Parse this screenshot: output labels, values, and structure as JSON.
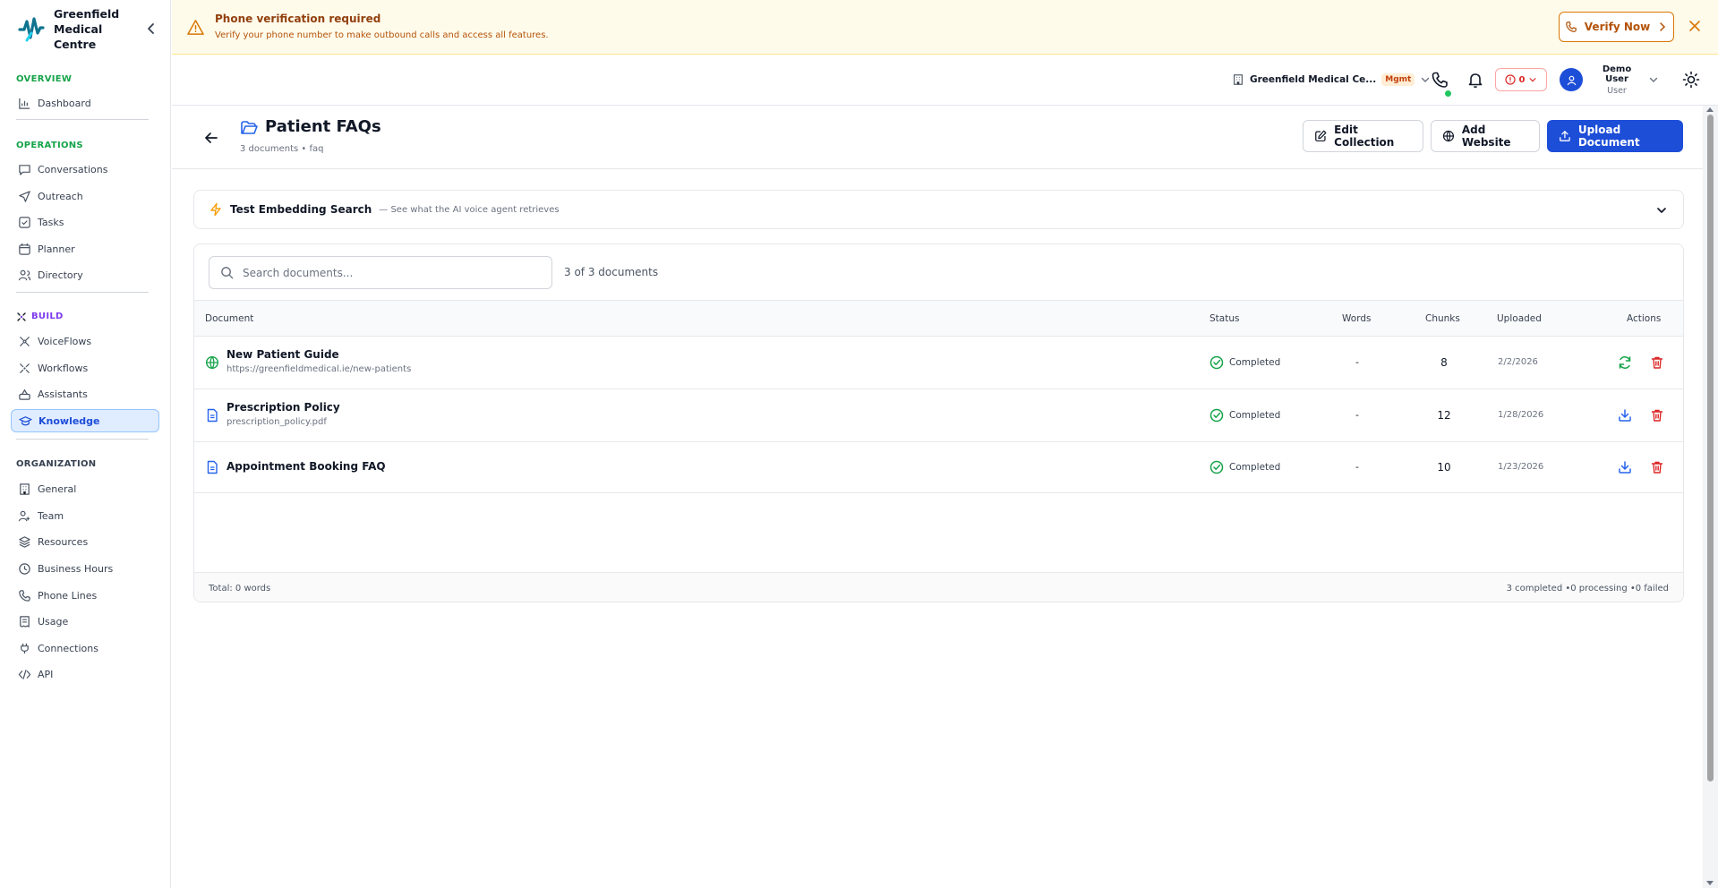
{
  "brand": {
    "name": "Greenfield Medical Centre"
  },
  "sidebar": {
    "overview_label": "OVERVIEW",
    "operations_label": "OPERATIONS",
    "build_label": "BUILD",
    "organization_label": "ORGANIZATION",
    "overview": [
      {
        "label": "Dashboard",
        "icon": "chart-icon"
      }
    ],
    "operations": [
      {
        "label": "Conversations",
        "icon": "chat-icon"
      },
      {
        "label": "Outreach",
        "icon": "send-icon"
      },
      {
        "label": "Tasks",
        "icon": "checklist-icon"
      },
      {
        "label": "Planner",
        "icon": "calendar-icon"
      },
      {
        "label": "Directory",
        "icon": "users-icon"
      }
    ],
    "build": [
      {
        "label": "VoiceFlows",
        "icon": "flow-icon"
      },
      {
        "label": "Workflows",
        "icon": "workflow-icon"
      },
      {
        "label": "Assistants",
        "icon": "bot-icon"
      },
      {
        "label": "Knowledge",
        "icon": "graduation-cap-icon",
        "active": true
      }
    ],
    "organization": [
      {
        "label": "General",
        "icon": "building-icon"
      },
      {
        "label": "Team",
        "icon": "team-icon"
      },
      {
        "label": "Resources",
        "icon": "layers-icon"
      },
      {
        "label": "Business Hours",
        "icon": "clock-icon"
      },
      {
        "label": "Phone Lines",
        "icon": "phone-icon"
      },
      {
        "label": "Usage",
        "icon": "receipt-icon"
      },
      {
        "label": "Connections",
        "icon": "plug-icon"
      },
      {
        "label": "API",
        "icon": "code-icon"
      }
    ]
  },
  "banner": {
    "title": "Phone verification required",
    "message": "Verify your phone number to make outbound calls and access all features.",
    "verify_label": "Verify Now"
  },
  "topbar": {
    "org_name": "Greenfield Medical Ce...",
    "org_badge": "Mgmt",
    "alert_count": "0",
    "user_name": "Demo User",
    "user_role": "User"
  },
  "page": {
    "title": "Patient FAQs",
    "subtitle": "3 documents • faq",
    "edit_label": "Edit Collection",
    "add_website_label": "Add Website",
    "upload_label": "Upload Document"
  },
  "embedding": {
    "title": "Test Embedding Search",
    "subtitle": "— See what the AI voice agent retrieves"
  },
  "documents": {
    "search_placeholder": "Search documents...",
    "count_text": "3 of 3 documents",
    "headers": {
      "document": "Document",
      "status": "Status",
      "words": "Words",
      "chunks": "Chunks",
      "uploaded": "Uploaded",
      "actions": "Actions"
    },
    "rows": [
      {
        "name": "New Patient Guide",
        "source": "https://greenfieldmedical.ie/new-patients",
        "type": "website",
        "status": "Completed",
        "words": "-",
        "chunks": "8",
        "uploaded": "2/2/2026",
        "action": "refresh"
      },
      {
        "name": "Prescription Policy",
        "source": "prescription_policy.pdf",
        "type": "file",
        "status": "Completed",
        "words": "-",
        "chunks": "12",
        "uploaded": "1/28/2026",
        "action": "download"
      },
      {
        "name": "Appointment Booking FAQ",
        "source": "",
        "type": "file",
        "status": "Completed",
        "words": "-",
        "chunks": "10",
        "uploaded": "1/23/2026",
        "action": "download"
      }
    ],
    "footer_total": "Total: 0 words",
    "footer_summary": "3 completed •0 processing •0 failed"
  },
  "colors": {
    "primary": "#1d4ed8",
    "success": "#16a34a",
    "danger": "#dc2626",
    "warning": "#d97706"
  }
}
